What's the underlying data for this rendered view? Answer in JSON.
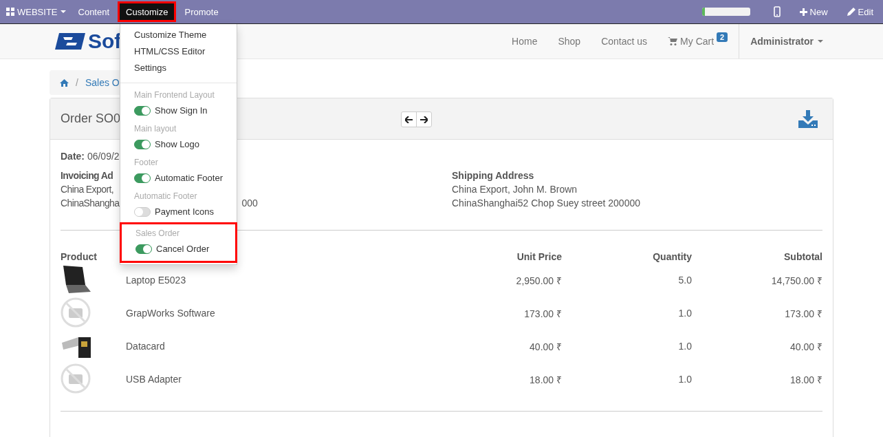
{
  "topbar": {
    "app_menu": "WEBSITE",
    "items": [
      {
        "label": "Content",
        "selected": false
      },
      {
        "label": "Customize",
        "selected": true
      },
      {
        "label": "Promote",
        "selected": false
      }
    ],
    "progress": {
      "level": 0.07
    },
    "new_label": "New",
    "edit_label": "Edit"
  },
  "header": {
    "logo_text": "Sof",
    "nav": [
      "Home",
      "Shop",
      "Contact us"
    ],
    "cart": {
      "label": "My Cart",
      "count": "2"
    },
    "user": "Administrator"
  },
  "breadcrumb": {
    "separator": "/",
    "items": [
      "Sales O"
    ]
  },
  "order": {
    "title": "Order SO0",
    "date_label": "Date:",
    "date_value": "06/09/2",
    "invoicing": {
      "heading": "Invoicing Ad",
      "lines": [
        "China Export,",
        "ChinaShangha"
      ],
      "tail": "000"
    },
    "shipping": {
      "heading": "Shipping Address",
      "lines": [
        "China Export, John M. Brown",
        "ChinaShanghai52 Chop Suey street 200000"
      ]
    },
    "columns": [
      "Product",
      "Unit Price",
      "Quantity",
      "Subtotal"
    ],
    "rows": [
      {
        "kind": "laptop",
        "name": "Laptop E5023",
        "unit_price": "2,950.00 ₹",
        "quantity": "5.0",
        "subtotal": "14,750.00 ₹"
      },
      {
        "kind": "none",
        "name": "GrapWorks Software",
        "unit_price": "173.00 ₹",
        "quantity": "1.0",
        "subtotal": "173.00 ₹"
      },
      {
        "kind": "datacard",
        "name": "Datacard",
        "unit_price": "40.00 ₹",
        "quantity": "1.0",
        "subtotal": "40.00 ₹"
      },
      {
        "kind": "none",
        "name": "USB Adapter",
        "unit_price": "18.00 ₹",
        "quantity": "1.0",
        "subtotal": "18.00 ₹"
      }
    ]
  },
  "dropdown": {
    "links": [
      "Customize Theme",
      "HTML/CSS Editor",
      "Settings"
    ],
    "sections": [
      {
        "heading": "Main Frontend Layout",
        "highlighted": false,
        "options": [
          {
            "label": "Show Sign In",
            "on": true
          }
        ]
      },
      {
        "heading": "Main layout",
        "highlighted": false,
        "options": [
          {
            "label": "Show Logo",
            "on": true
          }
        ]
      },
      {
        "heading": "Footer",
        "highlighted": false,
        "options": [
          {
            "label": "Automatic Footer",
            "on": true
          }
        ]
      },
      {
        "heading": "Automatic Footer",
        "highlighted": false,
        "options": [
          {
            "label": "Payment Icons",
            "on": false
          }
        ]
      },
      {
        "heading": "Sales Order",
        "highlighted": true,
        "options": [
          {
            "label": "Cancel Order",
            "on": true
          }
        ]
      }
    ]
  }
}
